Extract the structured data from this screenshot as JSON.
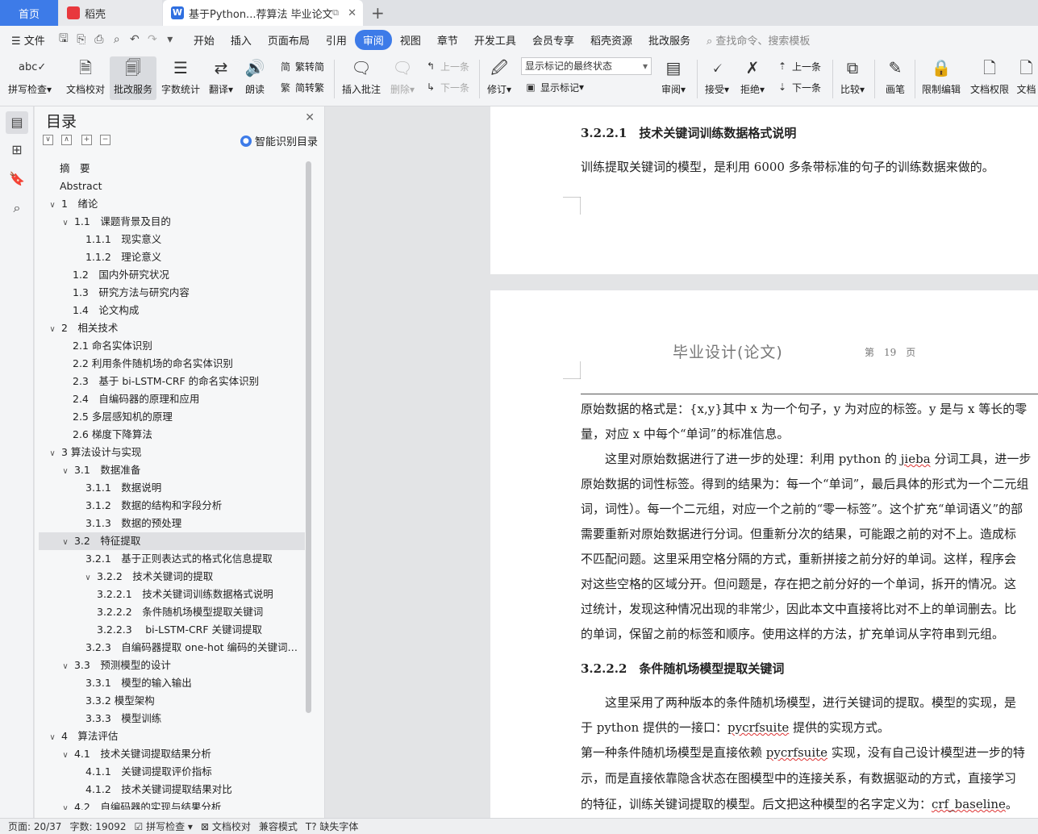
{
  "tabs": {
    "home": "首页",
    "daoke": "稻壳",
    "document": "基于Python...荐算法 毕业论文"
  },
  "menu": {
    "file": "文件",
    "items": [
      "开始",
      "插入",
      "页面布局",
      "引用",
      "审阅",
      "视图",
      "章节",
      "开发工具",
      "会员专享",
      "稻壳资源",
      "批改服务"
    ],
    "active": "审阅",
    "search_placeholder": "查找命令、搜索模板"
  },
  "ribbon": {
    "spell_check": "拼写检查",
    "doc_proof": "文档校对",
    "review_service": "批改服务",
    "word_count": "字数统计",
    "translate": "翻译",
    "read_aloud": "朗读",
    "trad_to_simp": "繁转简",
    "simp_to_trad": "简转繁",
    "insert_comment": "插入批注",
    "delete": "删除",
    "prev_comment": "上一条",
    "next_comment": "下一条",
    "track_changes": "修订",
    "markup_state": "显示标记的最终状态",
    "show_markup": "显示标记",
    "review": "审阅",
    "accept": "接受",
    "reject": "拒绝",
    "prev_change": "上一条",
    "next_change": "下一条",
    "compare": "比较",
    "pen": "画笔",
    "restrict_edit": "限制编辑",
    "doc_permission": "文档权限",
    "doc_more": "文档"
  },
  "toc": {
    "title": "目录",
    "smart_toc": "智能识别目录",
    "items": [
      {
        "text": "摘　要",
        "level": 0,
        "toggle": ""
      },
      {
        "text": "Abstract",
        "level": 0,
        "toggle": ""
      },
      {
        "text": "1　绪论",
        "level": 0,
        "toggle": "∨"
      },
      {
        "text": "1.1　课题背景及目的",
        "level": 1,
        "toggle": "∨"
      },
      {
        "text": "1.1.1　现实意义",
        "level": 2,
        "toggle": ""
      },
      {
        "text": "1.1.2　理论意义",
        "level": 2,
        "toggle": ""
      },
      {
        "text": "1.2　国内外研究状况",
        "level": 1,
        "toggle": ""
      },
      {
        "text": "1.3　研究方法与研究内容",
        "level": 1,
        "toggle": ""
      },
      {
        "text": "1.4　论文构成",
        "level": 1,
        "toggle": ""
      },
      {
        "text": "2　相关技术",
        "level": 0,
        "toggle": "∨"
      },
      {
        "text": "2.1 命名实体识别",
        "level": 1,
        "toggle": ""
      },
      {
        "text": "2.2 利用条件随机场的命名实体识别",
        "level": 1,
        "toggle": ""
      },
      {
        "text": "2.3　基于 bi-LSTM-CRF 的命名实体识别",
        "level": 1,
        "toggle": ""
      },
      {
        "text": "2.4　自编码器的原理和应用",
        "level": 1,
        "toggle": ""
      },
      {
        "text": "2.5 多层感知机的原理",
        "level": 1,
        "toggle": ""
      },
      {
        "text": "2.6 梯度下降算法",
        "level": 1,
        "toggle": ""
      },
      {
        "text": "3 算法设计与实现",
        "level": 0,
        "toggle": "∨"
      },
      {
        "text": "3.1　数据准备",
        "level": 1,
        "toggle": "∨"
      },
      {
        "text": "3.1.1　数据说明",
        "level": 2,
        "toggle": ""
      },
      {
        "text": "3.1.2　数据的结构和字段分析",
        "level": 2,
        "toggle": ""
      },
      {
        "text": "3.1.3　数据的预处理",
        "level": 2,
        "toggle": ""
      },
      {
        "text": "3.2　特征提取",
        "level": 1,
        "toggle": "∨",
        "selected": true
      },
      {
        "text": "3.2.1　基于正则表达式的格式化信息提取",
        "level": 2,
        "toggle": ""
      },
      {
        "text": "3.2.2　技术关键词的提取",
        "level": 2,
        "toggle": "∨"
      },
      {
        "text": "3.2.2.1　技术关键词训练数据格式说明",
        "level": 3,
        "toggle": ""
      },
      {
        "text": "3.2.2.2　条件随机场模型提取关键词",
        "level": 3,
        "toggle": ""
      },
      {
        "text": "3.2.2.3　 bi-LSTM-CRF 关键词提取",
        "level": 3,
        "toggle": ""
      },
      {
        "text": "3.2.3　自编码器提取 one-hot 编码的关键词特…",
        "level": 2,
        "toggle": ""
      },
      {
        "text": "3.3　预测模型的设计",
        "level": 1,
        "toggle": "∨"
      },
      {
        "text": "3.3.1　模型的输入输出",
        "level": 2,
        "toggle": ""
      },
      {
        "text": "3.3.2 模型架构",
        "level": 2,
        "toggle": ""
      },
      {
        "text": "3.3.3　模型训练",
        "level": 2,
        "toggle": ""
      },
      {
        "text": "4　算法评估",
        "level": 0,
        "toggle": "∨"
      },
      {
        "text": "4.1　技术关键词提取结果分析",
        "level": 1,
        "toggle": "∨"
      },
      {
        "text": "4.1.1　关键词提取评价指标",
        "level": 2,
        "toggle": ""
      },
      {
        "text": "4.1.2　技术关键词提取结果对比",
        "level": 2,
        "toggle": ""
      },
      {
        "text": "4.2　自编码器的实现与结果分析",
        "level": 1,
        "toggle": "∨"
      }
    ]
  },
  "document": {
    "page1": {
      "heading": "3.2.2.1　技术关键词训练数据格式说明",
      "para": "训练提取关键词的模型，是利用 6000 多条带标准的句子的训练数据来做的。"
    },
    "page2": {
      "header_title": "毕业设计(论文)",
      "header_page": "第　19　页",
      "lines": [
        "原始数据的格式是：{x,y}其中 x 为一个句子，y 为对应的标签。y 是与 x 等长的零",
        "量，对应 x 中每个“单词”的标准信息。",
        "　　这里对原始数据进行了进一步的处理：利用 python 的 jieba 分词工具，进一步",
        "原始数据的词性标签。得到的结果为：每一个“单词”，最后具体的形式为一个二元组",
        "词，词性）。每一个二元组，对应一个之前的“零一标签”。这个扩充“单词语义”的部",
        "需要重新对原始数据进行分词。但重新分次的结果，可能跟之前的对不上。造成标",
        "不匹配问题。这里采用空格分隔的方式，重新拼接之前分好的单词。这样，程序会",
        "对这些空格的区域分开。但问题是，存在把之前分好的一个单词，拆开的情况。这",
        "过统计，发现这种情况出现的非常少，因此本文中直接将比对不上的单词删去。比",
        "的单词，保留之前的标签和顺序。使用这样的方法，扩充单词从字符串到元组。"
      ],
      "heading2": "3.2.2.2　条件随机场模型提取关键词",
      "lines2": [
        "　　这里采用了两种版本的条件随机场模型，进行关键词的提取。模型的实现，是",
        "于 python 提供的一接口：pycrfsuite 提供的实现方式。",
        "第一种条件随机场模型是直接依赖 pycrfsuite 实现，没有自己设计模型进一步的特",
        "示，而是直接依靠隐含状态在图模型中的连接关系，有数据驱动的方式，直接学习",
        "的特征，训练关键词提取的模型。后文把这种模型的名字定义为：crf_baseline。"
      ]
    }
  },
  "status": {
    "page": "页面: 20/37",
    "word_count": "字数: 19092",
    "spell_check": "拼写检查",
    "doc_proof": "文档校对",
    "compat_mode": "兼容模式",
    "missing_font": "缺失字体"
  }
}
